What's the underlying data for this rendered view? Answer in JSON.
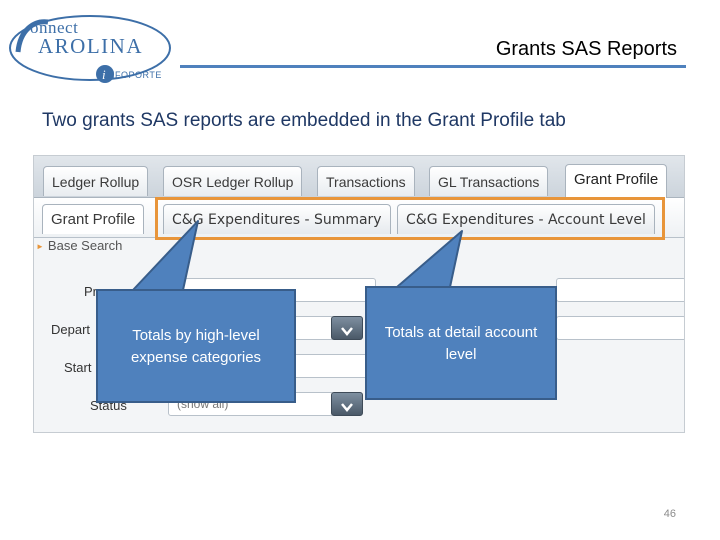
{
  "logo": {
    "connect": "onnect",
    "carolina": "AROLINA",
    "infoporte": "NFOPORTE"
  },
  "header": {
    "title": "Grants SAS Reports"
  },
  "subtitle": "Two grants SAS reports are embedded in the Grant Profile tab",
  "app": {
    "top_tabs": [
      {
        "label": "Ledger Rollup"
      },
      {
        "label": "OSR Ledger Rollup"
      },
      {
        "label": "Transactions"
      },
      {
        "label": "GL Transactions"
      },
      {
        "label": "Grant Profile"
      }
    ],
    "sub_tabs": [
      {
        "label": "Grant Profile"
      },
      {
        "label": "C&G Expenditures - Summary"
      },
      {
        "label": "C&G Expenditures - Account Level"
      }
    ],
    "base_search": "Base Search",
    "form": {
      "label_p": "Pr",
      "label_dept": "Depart",
      "label_start": "Start",
      "label_status": "Status",
      "status_value": "(show all)"
    }
  },
  "callouts": {
    "left": "Totals by high-level expense categories",
    "right": "Totals at detail account level"
  },
  "page_number": "46",
  "colors": {
    "accent_blue": "#4f81bd",
    "highlight_orange": "#e8953a"
  }
}
